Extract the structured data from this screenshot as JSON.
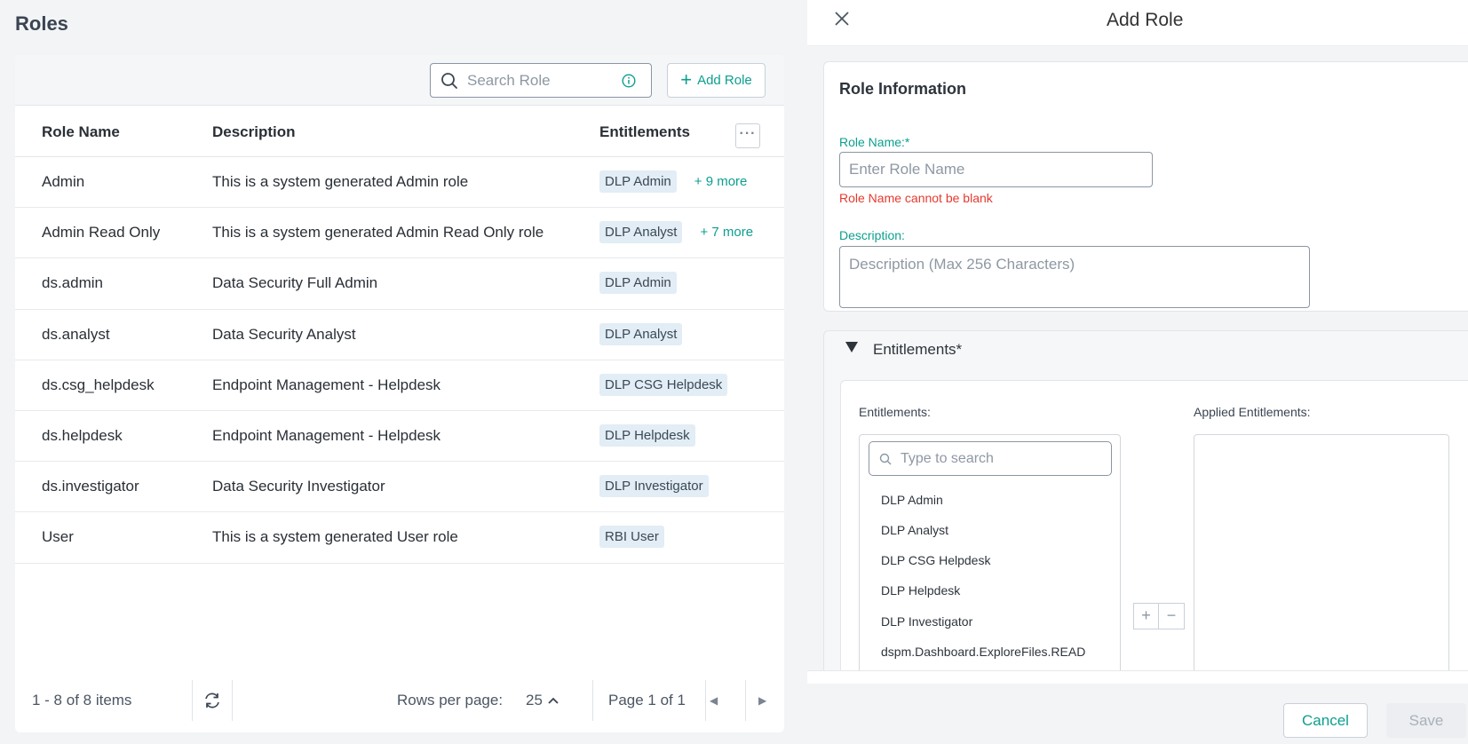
{
  "page": {
    "title": "Roles"
  },
  "toolbar": {
    "search_placeholder": "Search Role",
    "add_role_label": "Add Role"
  },
  "table": {
    "headers": {
      "name": "Role Name",
      "description": "Description",
      "entitlements": "Entitlements"
    },
    "more_label": "···",
    "rows": [
      {
        "name": "Admin",
        "description": "This is a system generated Admin role",
        "tag": "DLP Admin",
        "more": "+ 9 more"
      },
      {
        "name": "Admin Read Only",
        "description": "This is a system generated Admin Read Only role",
        "tag": "DLP Analyst",
        "more": "+ 7 more"
      },
      {
        "name": "ds.admin",
        "description": "Data Security Full Admin",
        "tag": "DLP Admin",
        "more": ""
      },
      {
        "name": "ds.analyst",
        "description": "Data Security Analyst",
        "tag": "DLP Analyst",
        "more": ""
      },
      {
        "name": "ds.csg_helpdesk",
        "description": "Endpoint Management - Helpdesk",
        "tag": "DLP CSG Helpdesk",
        "more": ""
      },
      {
        "name": "ds.helpdesk",
        "description": "Endpoint Management - Helpdesk",
        "tag": "DLP Helpdesk",
        "more": ""
      },
      {
        "name": "ds.investigator",
        "description": "Data Security Investigator",
        "tag": "DLP Investigator",
        "more": ""
      },
      {
        "name": "User",
        "description": "This is a system generated User role",
        "tag": "RBI User",
        "more": ""
      }
    ]
  },
  "footer": {
    "items_label": "1 - 8 of 8 items",
    "rows_per_page_label": "Rows per page:",
    "rows_per_page_value": "25",
    "page_label": "Page 1 of 1"
  },
  "drawer": {
    "title": "Add Role",
    "role_info_heading": "Role Information",
    "role_name_label": "Role Name:*",
    "role_name_placeholder": "Enter Role Name",
    "role_name_error": "Role Name cannot be blank",
    "description_label": "Description:",
    "description_placeholder": "Description (Max 256 Characters)",
    "entitlements_heading": "Entitlements*",
    "entitlements_label": "Entitlements:",
    "applied_label": "Applied Entitlements:",
    "type_search_placeholder": "Type to search",
    "options": [
      "DLP Admin",
      "DLP Analyst",
      "DLP CSG Helpdesk",
      "DLP Helpdesk",
      "DLP Investigator",
      "dspm.Dashboard.ExploreFiles.READ"
    ],
    "add_symbol": "+",
    "remove_symbol": "−",
    "cancel_label": "Cancel",
    "save_label": "Save"
  },
  "colors": {
    "accent": "#0c9f8e",
    "error": "#e6392e",
    "tag_bg": "#e2edf5"
  },
  "icons": [
    "search-icon",
    "info-icon",
    "plus-icon",
    "refresh-icon",
    "chevron-up-icon",
    "chevron-left-icon",
    "chevron-right-icon",
    "close-icon",
    "triangle-down-icon"
  ]
}
